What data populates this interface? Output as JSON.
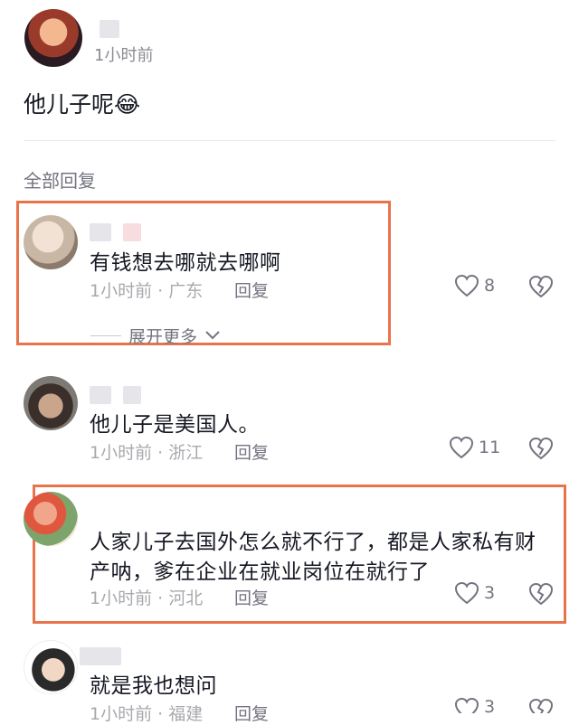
{
  "post": {
    "time": "1小时前",
    "text": "他儿子呢",
    "emoji": "😂"
  },
  "replies_header": "全部回复",
  "replies": [
    {
      "text": "有钱想去哪就去哪啊",
      "meta": "1小时前 · 广东",
      "reply": "回复",
      "likes": "8",
      "expand": "展开更多"
    },
    {
      "text": "他儿子是美国人。",
      "meta": "1小时前 · 浙江",
      "reply": "回复",
      "likes": "11"
    },
    {
      "text_line1": "人家儿子去国外怎么就不行了，都是人家私有财",
      "text_line2": "产呐，爹在企业在就业岗位在就行了",
      "meta": "1小时前 · 河北",
      "reply": "回复",
      "likes": "3"
    },
    {
      "text": "就是我也想问",
      "meta": "1小时前 · 福建",
      "reply": "回复",
      "likes": "3"
    }
  ],
  "colors": {
    "highlight": "#e8744c",
    "muted": "#a8a9ae",
    "text": "#161823"
  }
}
